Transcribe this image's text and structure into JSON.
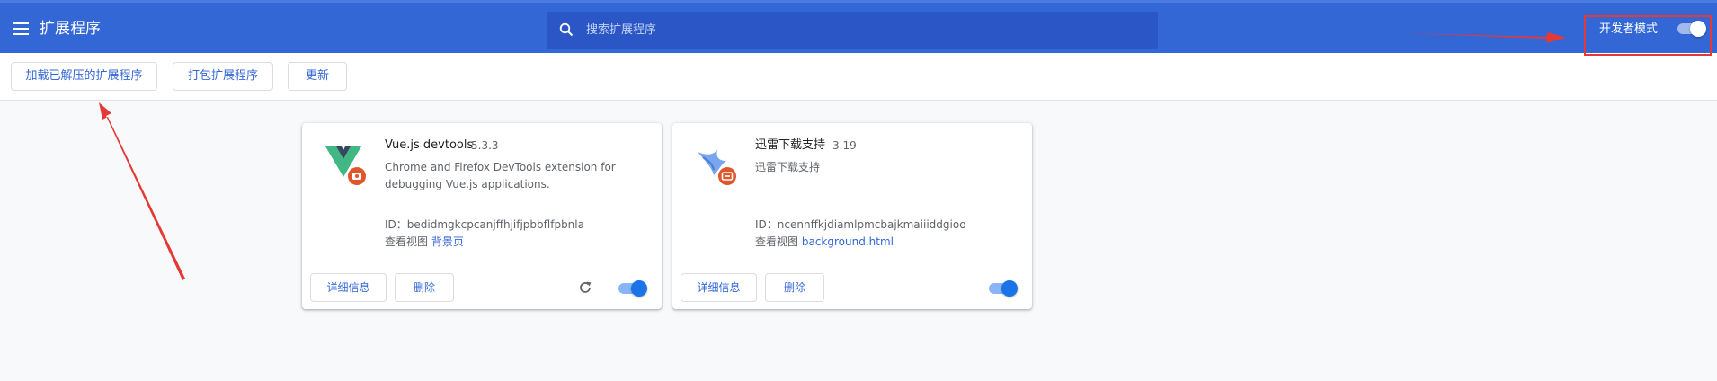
{
  "header": {
    "title": "扩展程序",
    "search": {
      "placeholder": "搜索扩展程序",
      "value": ""
    },
    "developer_mode": {
      "label": "开发者模式",
      "enabled": true
    }
  },
  "toolbar": {
    "load_unpacked_label": "加载已解压的扩展程序",
    "pack_label": "打包扩展程序",
    "update_label": "更新"
  },
  "extensions": [
    {
      "name": "Vue.js devtools",
      "version": "5.3.3",
      "description": "Chrome and Firefox DevTools extension for debugging Vue.js applications.",
      "id_label": "ID：",
      "id": "bedidmgkcpcanjffhjifjpbbflfpbnla",
      "views_label": "查看视图",
      "views_link": "背景页",
      "details_label": "详细信息",
      "remove_label": "删除",
      "enabled": true,
      "icon": "vue-logo-icon",
      "has_reload": true
    },
    {
      "name": "迅雷下载支持",
      "version": "3.19",
      "description": "迅雷下载支持",
      "id_label": "ID：",
      "id": "ncennffkjdiamlpmcbajkmaiiiddgioo",
      "views_label": "查看视图",
      "views_link": "background.html",
      "details_label": "详细信息",
      "remove_label": "删除",
      "enabled": true,
      "icon": "thunder-bird-icon",
      "has_reload": false
    }
  ],
  "colors": {
    "header_bg": "#3367d6",
    "search_bg": "#2a56c6",
    "accent": "#1a73e8",
    "annotation_red": "#e53935"
  }
}
